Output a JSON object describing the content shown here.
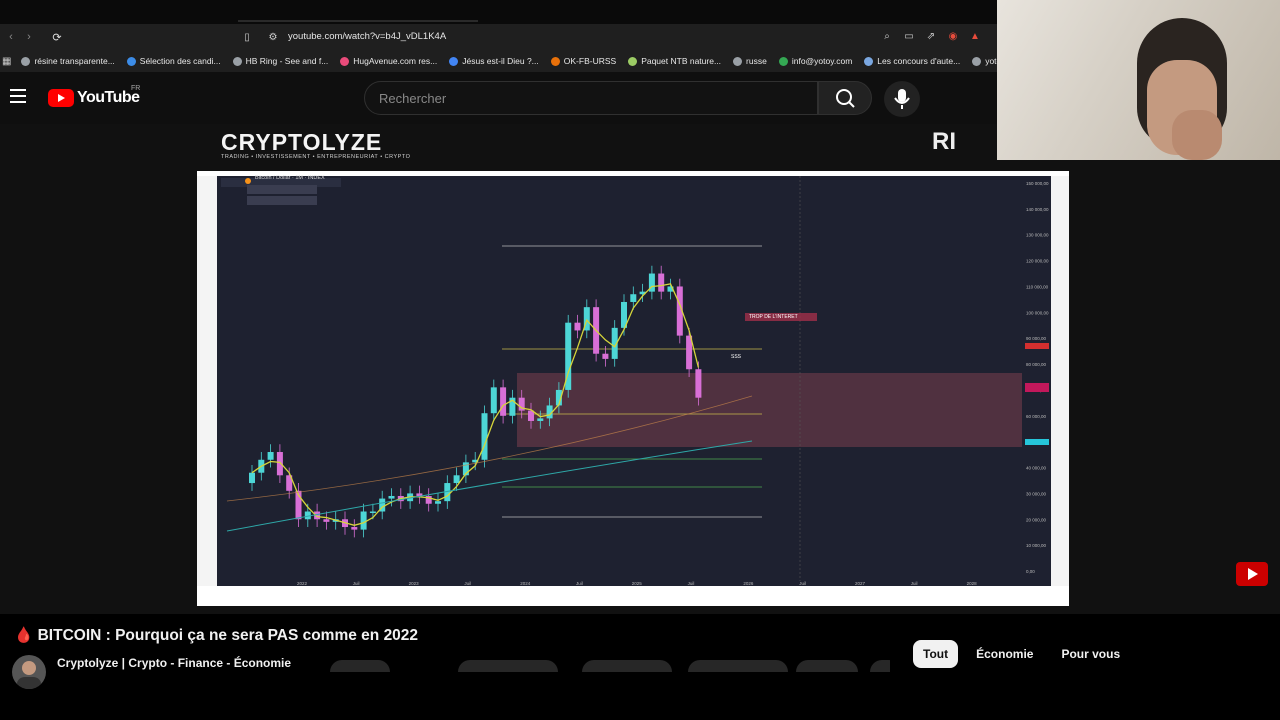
{
  "browser": {
    "url": "youtube.com/watch?v=b4J_vDL1K4A",
    "bookmarks": [
      {
        "label": "résine transparente...",
        "color": "#9aa0a6"
      },
      {
        "label": "Sélection des candi...",
        "color": "#3c8ce7"
      },
      {
        "label": "HB Ring - See and f...",
        "color": "#9aa0a6"
      },
      {
        "label": "HugAvenue.com res...",
        "color": "#e94b7a"
      },
      {
        "label": "Jésus est-il Dieu ?...",
        "color": "#4285f4"
      },
      {
        "label": "OK-FB-URSS",
        "color": "#e8710a"
      },
      {
        "label": "Paquet NTB nature...",
        "color": "#9ccc65"
      },
      {
        "label": "russe",
        "color": "#9aa0a6"
      },
      {
        "label": "info@yotoy.com",
        "color": "#34a853"
      },
      {
        "label": "Les concours d'aute...",
        "color": "#7aa7e0"
      },
      {
        "label": "yotoy",
        "color": "#9aa0a6"
      }
    ]
  },
  "youtube": {
    "logo_text": "YouTube",
    "region": "FR",
    "search_placeholder": "Rechercher"
  },
  "video": {
    "brand": "CRYPTOLYZE",
    "tagline": "TRADING • INVESTISSEMENT • ENTREPRENEURIAT • CRYPTO",
    "logo_partial": "RI",
    "chart_header": "Bitcoin / Dollar · 1M · INDEX",
    "chart_annotation": "TROP DE L'INTERET",
    "chart_label_sss": "SSS"
  },
  "chart_data": {
    "type": "candlestick",
    "title": "Bitcoin / Dollar · 1M · INDEX",
    "x_ticks": [
      "2022",
      "Juil",
      "2023",
      "Juil",
      "2024",
      "Juil",
      "2025",
      "Juil",
      "2026",
      "Juil",
      "2027",
      "Juil",
      "2028"
    ],
    "y_ticks": [
      "150 000,00",
      "140 000,00",
      "130 000,00",
      "120 000,00",
      "110 000,00",
      "100 000,00",
      "90 000,00",
      "80 000,00",
      "70 000,00",
      "60 000,00",
      "50 000,00",
      "40 000,00",
      "30 000,00",
      "20 000,00",
      "10 000,00",
      "0,00"
    ],
    "closes": [
      38,
      43,
      46,
      37,
      31,
      20,
      23,
      20,
      19,
      20,
      17,
      16,
      23,
      23,
      28,
      29,
      27,
      30,
      29,
      26,
      27,
      34,
      37,
      42,
      43,
      61,
      71,
      60,
      67,
      62,
      58,
      59,
      64,
      70,
      96,
      93,
      102,
      84,
      82,
      94,
      104,
      107,
      108,
      115,
      108,
      110,
      91,
      78,
      67
    ],
    "accent_colors": {
      "up": "#4dd6d6",
      "down": "#d86fd6",
      "ma": "#d6d63a",
      "zone": "#6b3a4a"
    }
  },
  "below": {
    "title": "🩸 BITCOIN : Pourquoi ça ne sera PAS comme en 2022",
    "channel": "Cryptolyze | Crypto - Finance - Économie",
    "chips": [
      "Tout",
      "Économie",
      "Pour vous"
    ]
  }
}
